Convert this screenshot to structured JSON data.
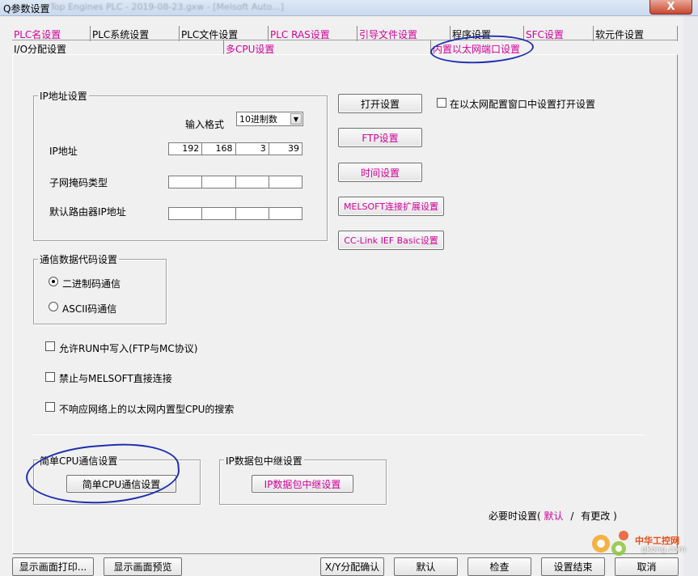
{
  "window": {
    "title": "Q参数设置",
    "title_blur": "Top Engines PLC - 2019-08-23.gxw - [Melsoft Auto...]",
    "close_label": "X"
  },
  "tabs": {
    "row1": [
      "PLC名设置",
      "PLC系统设置",
      "PLC文件设置",
      "PLC RAS设置",
      "引导文件设置",
      "程序设置",
      "SFC设置",
      "软元件设置"
    ],
    "row2": [
      "I/O分配设置",
      "多CPU设置",
      "内置以太网端口设置"
    ]
  },
  "ip_group": {
    "title": "IP地址设置",
    "format_label": "输入格式",
    "format_value": "10进制数",
    "ip_label": "IP地址",
    "ip_octets": [
      "192",
      "168",
      "3",
      "39"
    ],
    "mask_label": "子网掩码类型",
    "gateway_label": "默认路由器IP地址"
  },
  "right_buttons": {
    "open_setting": "打开设置",
    "open_checkbox_label": "在以太网配置窗口中设置打开设置",
    "ftp": "FTP设置",
    "time": "时间设置",
    "melsoft": "MELSOFT连接扩展设置",
    "cclink": "CC-Link IEF Basic设置"
  },
  "comm_group": {
    "title": "通信数据代码设置",
    "binary": "二进制码通信",
    "ascii": "ASCII码通信"
  },
  "checks": {
    "allow_run_write": "允许RUN中写入(FTP与MC协议)",
    "forbid_melsoft": "禁止与MELSOFT直接连接",
    "no_respond_search": "不响应网络上的以太网内置型CPU的搜索"
  },
  "simple_cpu": {
    "title": "简单CPU通信设置",
    "button": "简单CPU通信设置"
  },
  "ip_relay": {
    "title": "IP数据包中继设置",
    "button": "IP数据包中继设置"
  },
  "legend": {
    "prefix": "必要时设置(",
    "default": "默认",
    "slash": "/",
    "changed": "有更改",
    "suffix": ")"
  },
  "bottom_buttons": {
    "print": "显示画面打印...",
    "preview": "显示画面预览",
    "xy": "X/Y分配确认",
    "default": "默认",
    "check": "检查",
    "finish": "设置结束",
    "cancel": "取消"
  },
  "watermark": {
    "cn": "中华工控网",
    "url": "gkong.com"
  },
  "colors": {
    "changed_text": "#d4009a",
    "annotation_ink": "#1f2fb0"
  }
}
